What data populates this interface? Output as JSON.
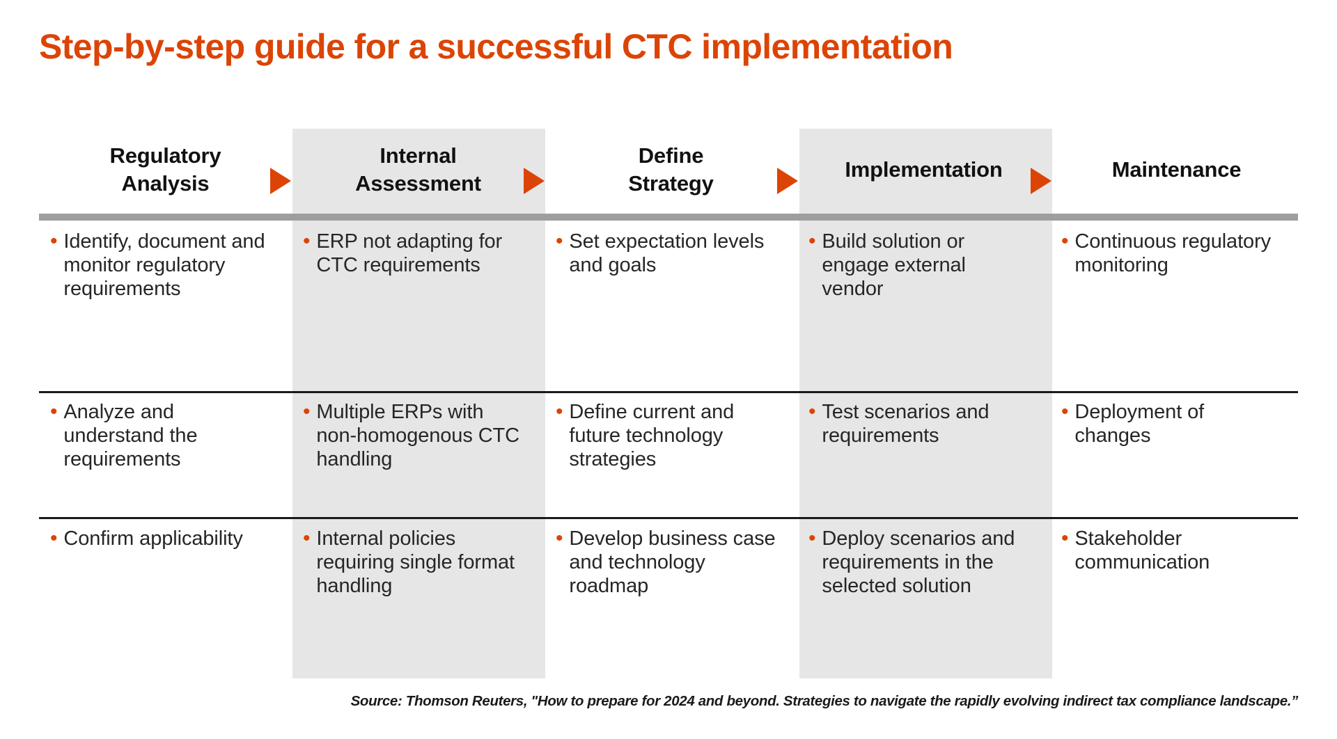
{
  "title": "Step-by-step guide for a successful CTC implementation",
  "colors": {
    "accent": "#DC4405",
    "shaded_column": "#E6E6E6",
    "header_rule": "#9E9E9E",
    "row_rule": "#1A1A1A",
    "text": "#262626"
  },
  "columns": [
    {
      "label": "Regulatory\nAnalysis",
      "label_line1": "Regulatory",
      "label_line2": "Analysis",
      "shaded": false
    },
    {
      "label": "Internal\nAssessment",
      "label_line1": "Internal",
      "label_line2": "Assessment",
      "shaded": true
    },
    {
      "label": "Define\nStrategy",
      "label_line1": "Define",
      "label_line2": "Strategy",
      "shaded": false
    },
    {
      "label": "Implementation",
      "label_line1": "Implementation",
      "label_line2": "",
      "shaded": true
    },
    {
      "label": "Maintenance",
      "label_line1": "Maintenance",
      "label_line2": "",
      "shaded": false
    }
  ],
  "arrows": [
    {
      "name": "arrow-1",
      "glyph": "triangle-right-icon"
    },
    {
      "name": "arrow-2",
      "glyph": "triangle-right-icon"
    },
    {
      "name": "arrow-3",
      "glyph": "triangle-right-icon"
    },
    {
      "name": "arrow-4",
      "glyph": "triangle-right-icon"
    }
  ],
  "bullet_glyph": "•",
  "rows": [
    {
      "cells": [
        "Identify, document and monitor regulatory requirements",
        "ERP not adapting for CTC requirements",
        "Set expectation levels and goals",
        "Build solution or engage external vendor",
        "Continuous regulatory monitoring"
      ]
    },
    {
      "cells": [
        "Analyze and understand the requirements",
        "Multiple ERPs with non-homogenous CTC handling",
        "Define current and future technology strategies",
        "Test scenarios and requirements",
        "Deployment of changes"
      ]
    },
    {
      "cells": [
        "Confirm applicability",
        "Internal policies requiring single format handling",
        "Develop business case and technology roadmap",
        "Deploy scenarios and requirements in the selected solution",
        "Stakeholder communication"
      ]
    }
  ],
  "source": "Source: Thomson Reuters, \"How to prepare for 2024 and beyond. Strategies to navigate the rapidly evolving indirect tax compliance landscape.”"
}
